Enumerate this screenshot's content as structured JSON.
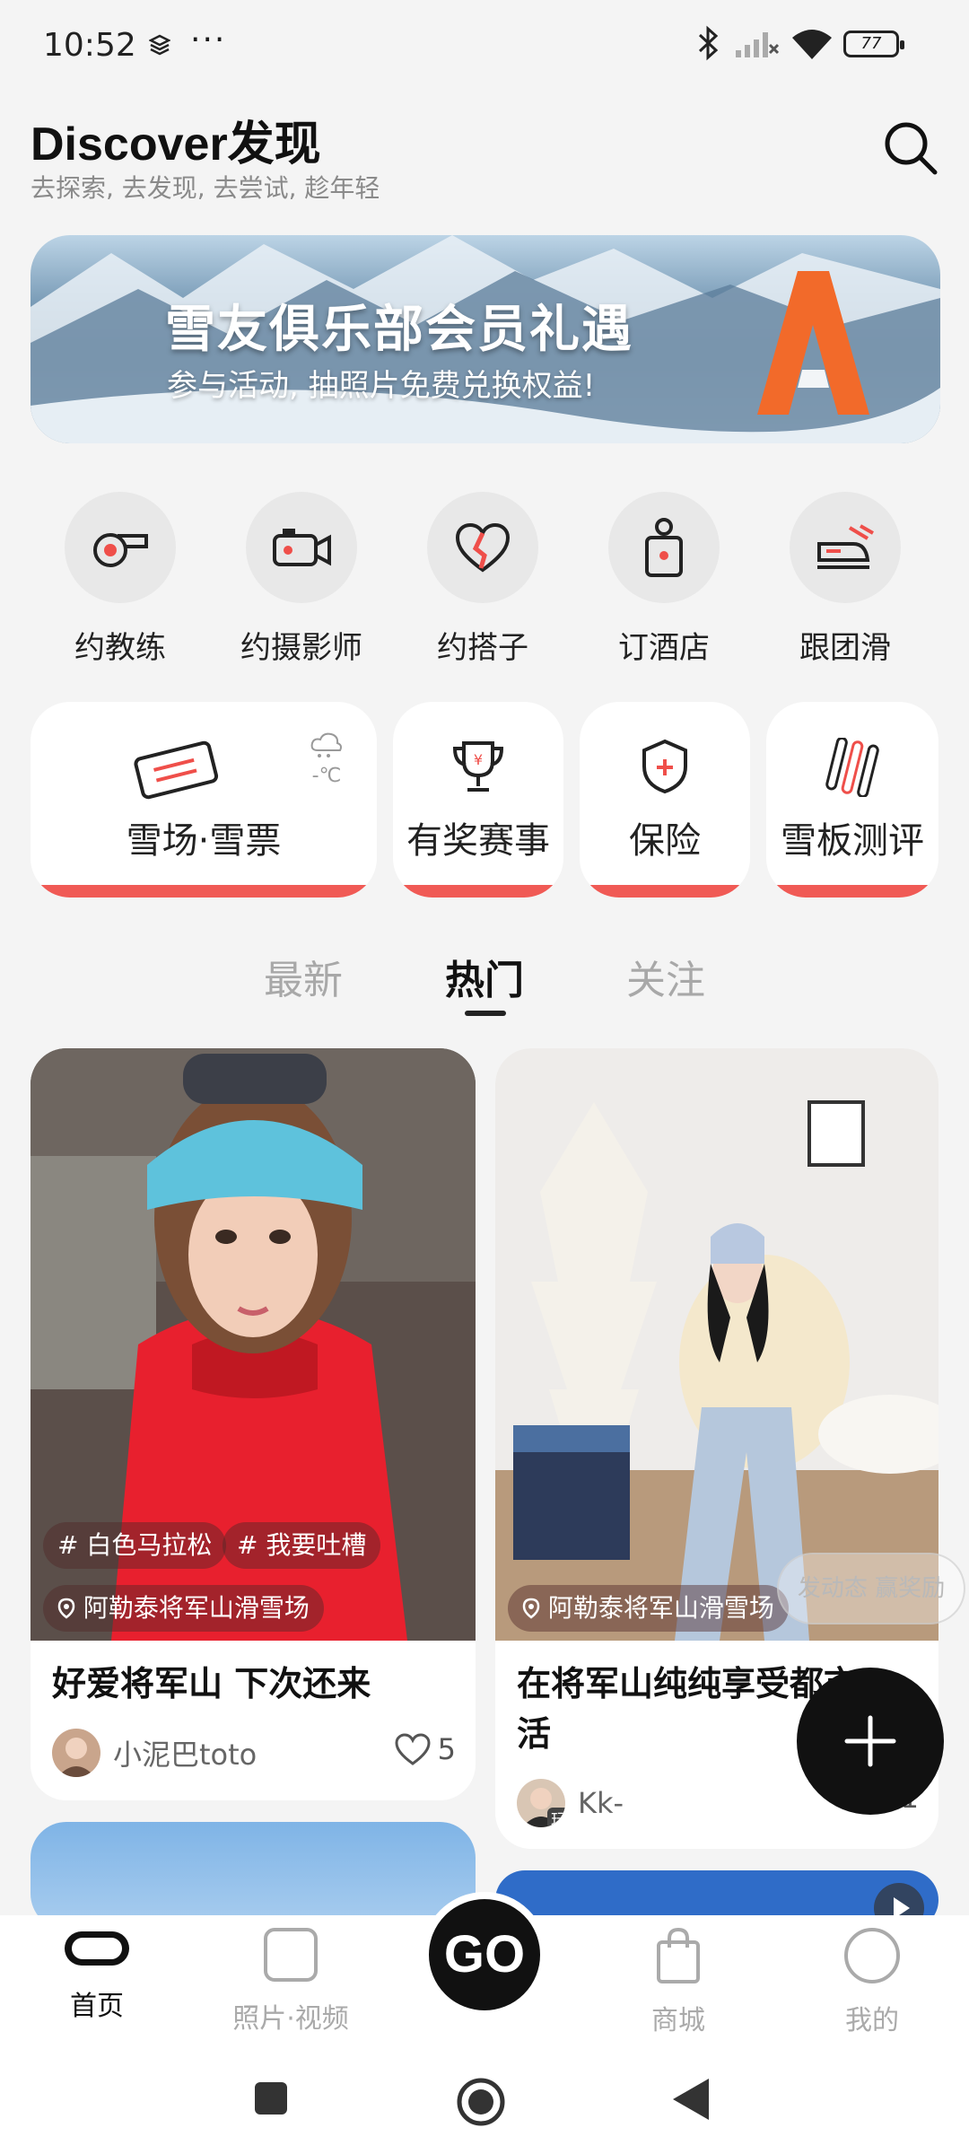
{
  "status": {
    "time": "10:52",
    "dots": "···",
    "battery": "77"
  },
  "header": {
    "title": "Discover发现",
    "subtitle": "去探索, 去发现, 去尝试, 趁年轻"
  },
  "banner": {
    "headline": "雪友俱乐部会员礼遇",
    "subline": "参与活动, 抽照片免费兑换权益!"
  },
  "quick_actions": [
    {
      "label": "约教练",
      "icon": "whistle-icon"
    },
    {
      "label": "约摄影师",
      "icon": "camera-icon"
    },
    {
      "label": "约搭子",
      "icon": "heart-icon"
    },
    {
      "label": "订酒店",
      "icon": "door-hanger-icon"
    },
    {
      "label": "跟团滑",
      "icon": "train-icon"
    }
  ],
  "feature_cards": [
    {
      "label": "雪场·雪票",
      "weather": "-℃"
    },
    {
      "label": "有奖赛事"
    },
    {
      "label": "保险"
    },
    {
      "label": "雪板测评"
    }
  ],
  "tabs": [
    "最新",
    "热门",
    "关注"
  ],
  "active_tab": "热门",
  "posts": [
    {
      "tags": [
        "白色马拉松",
        "我要吐槽"
      ],
      "location": "阿勒泰将军山滑雪场",
      "title": "好爱将军山 下次还来",
      "author": "小泥巴toto",
      "likes": "5"
    },
    {
      "location": "阿勒泰将军山滑雪场",
      "title": "在将军山纯纯享受都市",
      "title2": "活",
      "author": "Kk-",
      "avatar_badge": "玩",
      "likes": "1"
    }
  ],
  "bubble": "发动态 赢奖励",
  "bottom_nav": [
    {
      "label": "首页",
      "active": true
    },
    {
      "label": "照片·视频"
    },
    {
      "label": "GO"
    },
    {
      "label": "商城"
    },
    {
      "label": "我的"
    }
  ],
  "colors": {
    "accent": "#f05a55",
    "text": "#1a1a1a",
    "muted": "#a8a8a8"
  }
}
